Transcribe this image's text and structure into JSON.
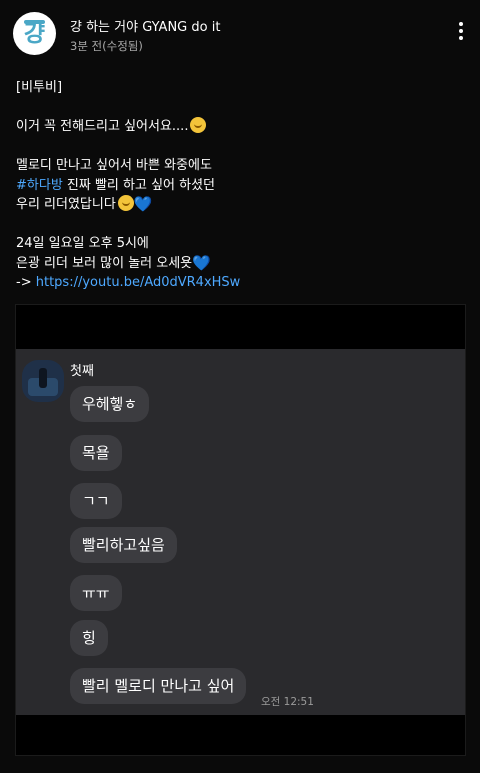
{
  "header": {
    "channel_name": "걍 하는 거야 GYANG do it",
    "avatar_text": "걍",
    "timestamp": "3분 전(수정됨)",
    "more_icon": "more-vertical-icon"
  },
  "post": {
    "lines": [
      "[비투비]",
      "",
      "이거 꼭 전해드리고 싶어서요....",
      "",
      "멜로디 만나고 싶어서 바쁜 와중에도",
      "진짜 빨리 하고 싶어 하셨던",
      "우리 리더였답니다",
      "",
      "24일 일요일 오후 5시에",
      "은광 리더 보러 많이 놀러 오세욧",
      "->"
    ],
    "hashtag": "#하다방",
    "url": "https://youtu.be/Ad0dVR4xHSw",
    "heart_glyph": "💙"
  },
  "chat": {
    "sender": "첫째",
    "messages": [
      "우헤헿ㅎ",
      "목욜",
      "ㄱㄱ",
      "빨리하고싶음",
      "ㅠㅠ",
      "힝",
      "빨리 멜로디 만나고 싶어"
    ],
    "time": "오전 12:51"
  },
  "colors": {
    "background": "#0a0a0a",
    "link": "#4ea9ff",
    "bubble": "#3c3c40",
    "chat_bg": "#2a2a2d",
    "avatar_accent": "#4aa7c6"
  }
}
